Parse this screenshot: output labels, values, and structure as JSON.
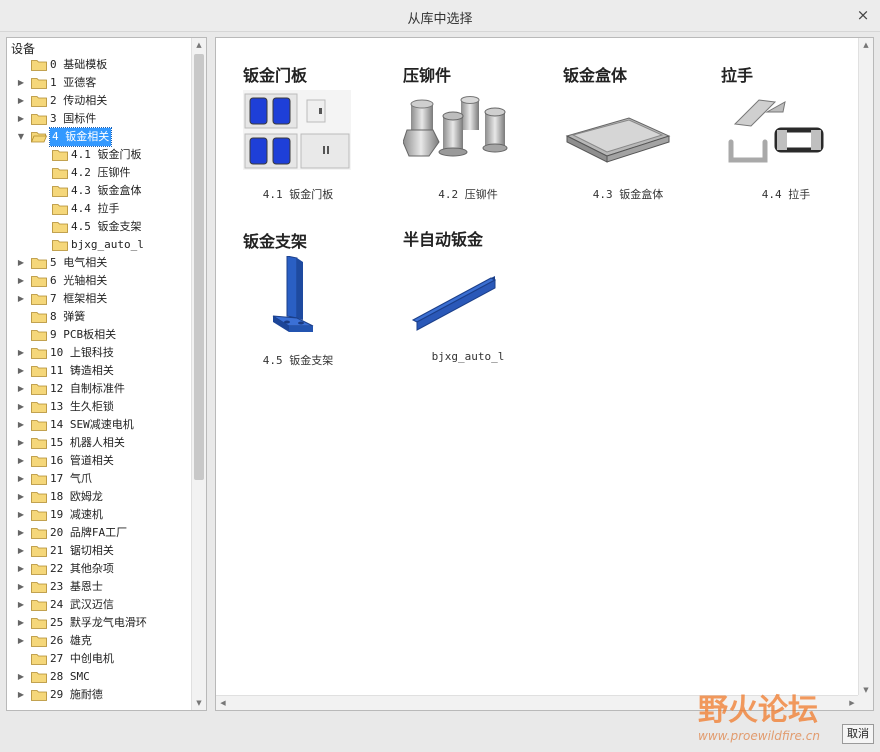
{
  "window": {
    "title": "从库中选择",
    "close_glyph": "×"
  },
  "tree": {
    "header": "设备",
    "items": [
      {
        "label": "0 基础模板",
        "arrow": "",
        "level": 0
      },
      {
        "label": "1 亚德客",
        "arrow": "▶",
        "level": 0
      },
      {
        "label": "2 传动相关",
        "arrow": "▶",
        "level": 0
      },
      {
        "label": "3 国标件",
        "arrow": "▶",
        "level": 0
      },
      {
        "label": "4 钣金相关",
        "arrow": "▼",
        "level": 0,
        "selected": true,
        "open": true
      },
      {
        "label": "4.1 钣金门板",
        "arrow": "",
        "level": 1
      },
      {
        "label": "4.2 压铆件",
        "arrow": "",
        "level": 1
      },
      {
        "label": "4.3 钣金盒体",
        "arrow": "",
        "level": 1
      },
      {
        "label": "4.4 拉手",
        "arrow": "",
        "level": 1
      },
      {
        "label": "4.5 钣金支架",
        "arrow": "",
        "level": 1
      },
      {
        "label": "bjxg_auto_l",
        "arrow": "",
        "level": 1
      },
      {
        "label": "5 电气相关",
        "arrow": "▶",
        "level": 0
      },
      {
        "label": "6 光轴相关",
        "arrow": "▶",
        "level": 0
      },
      {
        "label": "7 框架相关",
        "arrow": "▶",
        "level": 0
      },
      {
        "label": "8 弹簧",
        "arrow": "",
        "level": 0
      },
      {
        "label": "9 PCB板相关",
        "arrow": "",
        "level": 0
      },
      {
        "label": "10 上银科技",
        "arrow": "▶",
        "level": 0
      },
      {
        "label": "11 铸造相关",
        "arrow": "▶",
        "level": 0
      },
      {
        "label": "12 自制标准件",
        "arrow": "▶",
        "level": 0
      },
      {
        "label": "13 生久柜锁",
        "arrow": "▶",
        "level": 0
      },
      {
        "label": "14 SEW减速电机",
        "arrow": "▶",
        "level": 0
      },
      {
        "label": "15 机器人相关",
        "arrow": "▶",
        "level": 0
      },
      {
        "label": "16 管道相关",
        "arrow": "▶",
        "level": 0
      },
      {
        "label": "17 气爪",
        "arrow": "▶",
        "level": 0
      },
      {
        "label": "18 欧姆龙",
        "arrow": "▶",
        "level": 0
      },
      {
        "label": "19 减速机",
        "arrow": "▶",
        "level": 0
      },
      {
        "label": "20 品牌FA工厂",
        "arrow": "▶",
        "level": 0
      },
      {
        "label": "21 锯切相关",
        "arrow": "▶",
        "level": 0
      },
      {
        "label": "22 其他杂项",
        "arrow": "▶",
        "level": 0
      },
      {
        "label": "23 基恩士",
        "arrow": "▶",
        "level": 0
      },
      {
        "label": "24 武汉迈信",
        "arrow": "▶",
        "level": 0
      },
      {
        "label": "25 默孚龙气电滑环",
        "arrow": "▶",
        "level": 0
      },
      {
        "label": "26 雄克",
        "arrow": "▶",
        "level": 0
      },
      {
        "label": "27 中创电机",
        "arrow": "",
        "level": 0
      },
      {
        "label": "28 SMC",
        "arrow": "▶",
        "level": 0
      },
      {
        "label": "29 施耐德",
        "arrow": "▶",
        "level": 0
      }
    ]
  },
  "cards": [
    {
      "heading": "钣金门板",
      "caption": "4.1 钣金门板",
      "icon": "sheet-metal-door-panel"
    },
    {
      "heading": "压铆件",
      "caption": "4.2 压铆件",
      "icon": "press-rivet-nuts"
    },
    {
      "heading": "钣金盒体",
      "caption": "4.3 钣金盒体",
      "icon": "sheet-metal-tray"
    },
    {
      "heading": "拉手",
      "caption": "4.4 拉手",
      "icon": "handles"
    },
    {
      "heading": "钣金支架",
      "caption": "4.5 钣金支架",
      "icon": "l-bracket"
    },
    {
      "heading": "半自动钣金",
      "caption": "bjxg_auto_l",
      "icon": "angle-bar"
    }
  ],
  "watermark": {
    "text": "野火论坛",
    "url": "www.proewildfire.cn"
  },
  "buttons": {
    "cancel": "取消"
  },
  "colors": {
    "selection": "#3399ff",
    "folder": "#f5d77a",
    "door_blue": "#1e3fd8",
    "part_blue": "#2a5fc4",
    "watermark": "#f07a2a"
  }
}
